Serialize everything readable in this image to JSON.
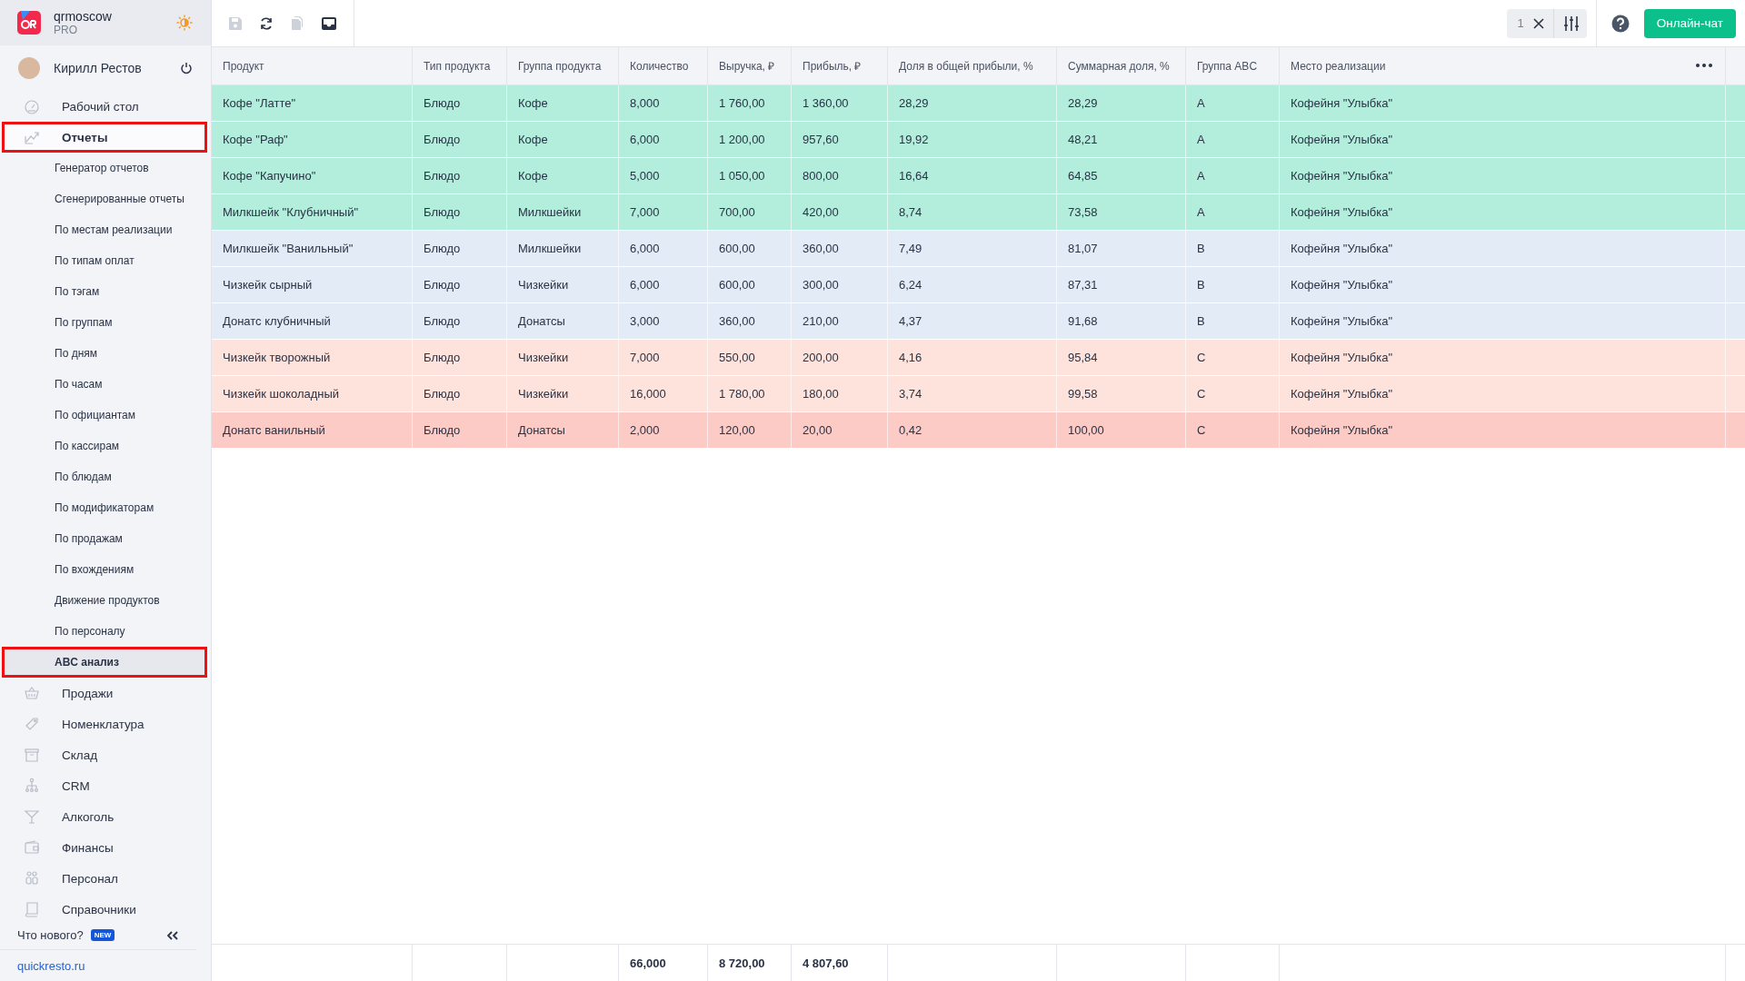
{
  "brand": {
    "name": "qrmoscow",
    "plan": "PRO"
  },
  "user": {
    "name": "Кирилл Рестов"
  },
  "nav": [
    {
      "label": "Рабочий стол",
      "selected": false,
      "highlighted": false
    },
    {
      "label": "Отчеты",
      "selected": true,
      "highlighted": true,
      "children": [
        {
          "label": "Генератор отчетов",
          "selected": false,
          "highlighted": false
        },
        {
          "label": "Сгенерированные отчеты",
          "selected": false,
          "highlighted": false
        },
        {
          "label": "По местам реализации",
          "selected": false,
          "highlighted": false
        },
        {
          "label": "По типам оплат",
          "selected": false,
          "highlighted": false
        },
        {
          "label": "По тэгам",
          "selected": false,
          "highlighted": false
        },
        {
          "label": "По группам",
          "selected": false,
          "highlighted": false
        },
        {
          "label": "По дням",
          "selected": false,
          "highlighted": false
        },
        {
          "label": "По часам",
          "selected": false,
          "highlighted": false
        },
        {
          "label": "По официантам",
          "selected": false,
          "highlighted": false
        },
        {
          "label": "По кассирам",
          "selected": false,
          "highlighted": false
        },
        {
          "label": "По блюдам",
          "selected": false,
          "highlighted": false
        },
        {
          "label": "По модификаторам",
          "selected": false,
          "highlighted": false
        },
        {
          "label": "По продажам",
          "selected": false,
          "highlighted": false
        },
        {
          "label": "По вхождениям",
          "selected": false,
          "highlighted": false
        },
        {
          "label": "Движение продуктов",
          "selected": false,
          "highlighted": false
        },
        {
          "label": "По персоналу",
          "selected": false,
          "highlighted": false
        },
        {
          "label": "ABC анализ",
          "selected": true,
          "highlighted": true
        }
      ]
    },
    {
      "label": "Продажи",
      "selected": false,
      "highlighted": false
    },
    {
      "label": "Номенклатура",
      "selected": false,
      "highlighted": false
    },
    {
      "label": "Склад",
      "selected": false,
      "highlighted": false
    },
    {
      "label": "CRM",
      "selected": false,
      "highlighted": false
    },
    {
      "label": "Алкоголь",
      "selected": false,
      "highlighted": false
    },
    {
      "label": "Финансы",
      "selected": false,
      "highlighted": false
    },
    {
      "label": "Персонал",
      "selected": false,
      "highlighted": false
    },
    {
      "label": "Справочники",
      "selected": false,
      "highlighted": false
    }
  ],
  "whats_new": {
    "label": "Что нового?",
    "badge": "NEW"
  },
  "site_link": "quickresto.ru",
  "toolbar": {
    "filter_count": "1",
    "chat_button": "Онлайн-чат"
  },
  "table": {
    "columns": [
      "Продукт",
      "Тип продукта",
      "Группа продукта",
      "Количество",
      "Выручка, ₽",
      "Прибыль, ₽",
      "Доля в общей прибыли, %",
      "Суммарная доля, %",
      "Группа ABC",
      "Место реализации"
    ],
    "rows": [
      {
        "color": "#b3eddc",
        "cells": [
          "Кофе \"Латте\"",
          "Блюдо",
          "Кофе",
          "8,000",
          "1 760,00",
          "1 360,00",
          "28,29",
          "28,29",
          "A",
          "Кофейня \"Улыбка\""
        ]
      },
      {
        "color": "#b3eddc",
        "cells": [
          "Кофе \"Раф\"",
          "Блюдо",
          "Кофе",
          "6,000",
          "1 200,00",
          "957,60",
          "19,92",
          "48,21",
          "A",
          "Кофейня \"Улыбка\""
        ]
      },
      {
        "color": "#b3eddc",
        "cells": [
          "Кофе \"Капучино\"",
          "Блюдо",
          "Кофе",
          "5,000",
          "1 050,00",
          "800,00",
          "16,64",
          "64,85",
          "A",
          "Кофейня \"Улыбка\""
        ]
      },
      {
        "color": "#b3eddc",
        "cells": [
          "Милкшейк \"Клубничный\"",
          "Блюдо",
          "Милкшейки",
          "7,000",
          "700,00",
          "420,00",
          "8,74",
          "73,58",
          "A",
          "Кофейня \"Улыбка\""
        ]
      },
      {
        "color": "#e3ebf7",
        "cells": [
          "Милкшейк \"Ванильный\"",
          "Блюдо",
          "Милкшейки",
          "6,000",
          "600,00",
          "360,00",
          "7,49",
          "81,07",
          "B",
          "Кофейня \"Улыбка\""
        ]
      },
      {
        "color": "#e3ebf7",
        "cells": [
          "Чизкейк сырный",
          "Блюдо",
          "Чизкейки",
          "6,000",
          "600,00",
          "300,00",
          "6,24",
          "87,31",
          "B",
          "Кофейня \"Улыбка\""
        ]
      },
      {
        "color": "#e3ebf7",
        "cells": [
          "Донатс клубничный",
          "Блюдо",
          "Донатсы",
          "3,000",
          "360,00",
          "210,00",
          "4,37",
          "91,68",
          "B",
          "Кофейня \"Улыбка\""
        ]
      },
      {
        "color": "#fde3dc",
        "cells": [
          "Чизкейк творожный",
          "Блюдо",
          "Чизкейки",
          "7,000",
          "550,00",
          "200,00",
          "4,16",
          "95,84",
          "C",
          "Кофейня \"Улыбка\""
        ]
      },
      {
        "color": "#fde3dc",
        "cells": [
          "Чизкейк шоколадный",
          "Блюдо",
          "Чизкейки",
          "16,000",
          "1 780,00",
          "180,00",
          "3,74",
          "99,58",
          "C",
          "Кофейня \"Улыбка\""
        ]
      },
      {
        "color": "#fccbc6",
        "cells": [
          "Донатс ванильный",
          "Блюдо",
          "Донатсы",
          "2,000",
          "120,00",
          "20,00",
          "0,42",
          "100,00",
          "C",
          "Кофейня \"Улыбка\""
        ]
      }
    ],
    "totals": {
      "quantity": "66,000",
      "revenue": "8 720,00",
      "profit": "4 807,60"
    }
  }
}
